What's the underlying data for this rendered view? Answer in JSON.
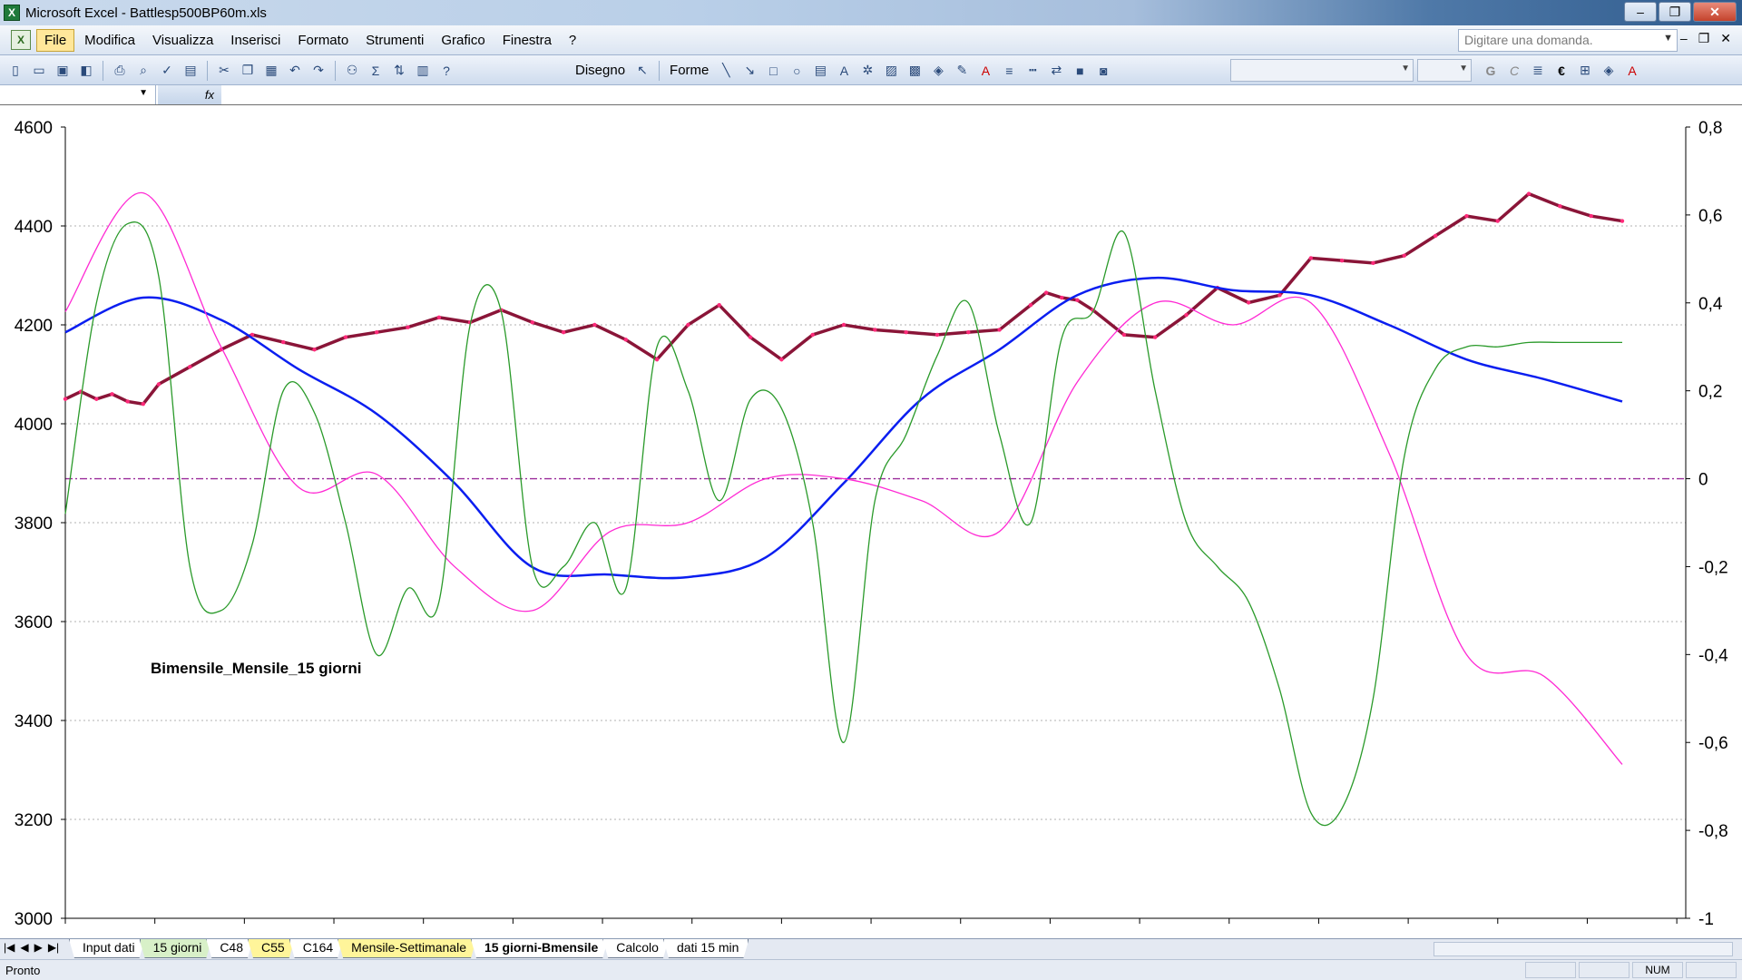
{
  "window": {
    "title": "Microsoft Excel - Battlesp500BP60m.xls",
    "app_icon": "excel-icon"
  },
  "menu": {
    "items": [
      "File",
      "Modifica",
      "Visualizza",
      "Inserisci",
      "Formato",
      "Strumenti",
      "Grafico",
      "Finestra",
      "?"
    ],
    "active": "File",
    "help_placeholder": "Digitare una domanda."
  },
  "toolbar": {
    "drawing_label": "Disegno",
    "shapes_label": "Forme",
    "currency_symbol": "€",
    "bold_label": "G",
    "italic_label": "C",
    "sum_symbol": "Σ"
  },
  "formula_bar": {
    "name_box": "",
    "fx_label": "fx",
    "content": ""
  },
  "chart_data": {
    "type": "line",
    "annotation": "Bimensile_Mensile_15 giorni",
    "annotation_color": "#1a8a1a",
    "ylim": [
      3000,
      4600
    ],
    "y_ticks": [
      "4600",
      "4400",
      "4200",
      "4000",
      "3800",
      "3600",
      "3400",
      "3200",
      "3000"
    ],
    "y2lim": [
      -1,
      0.8
    ],
    "y2_ticks": [
      "0,8",
      "0,6",
      "0,4",
      "0,2",
      "0",
      "-0,2",
      "-0,4",
      "-0,6",
      "-0,8",
      "-1"
    ],
    "grid": "horizontal dotted",
    "zero_line_color": "#9b2d9b",
    "x_range": [
      0,
      100
    ],
    "series": [
      {
        "axis": "left",
        "color": "#8a1538",
        "marker_color": "#ff2a7a",
        "x": [
          0,
          1,
          2,
          3,
          4,
          5,
          6,
          8,
          10,
          12,
          14,
          16,
          18,
          20,
          22,
          24,
          26,
          28,
          30,
          32,
          34,
          36,
          38,
          40,
          42,
          44,
          46,
          48,
          50,
          52,
          54,
          56,
          58,
          60,
          62,
          63,
          64,
          65,
          66,
          68,
          70,
          72,
          74,
          76,
          78,
          80,
          82,
          84,
          86,
          88,
          90,
          92,
          94,
          96,
          98,
          100
        ],
        "values": [
          4050,
          4065,
          4050,
          4060,
          4045,
          4040,
          4080,
          4115,
          4150,
          4180,
          4165,
          4150,
          4175,
          4185,
          4195,
          4215,
          4205,
          4230,
          4205,
          4185,
          4200,
          4170,
          4130,
          4200,
          4240,
          4175,
          4130,
          4180,
          4200,
          4190,
          4185,
          4180,
          4185,
          4190,
          4240,
          4265,
          4255,
          4250,
          4230,
          4180,
          4175,
          4220,
          4275,
          4245,
          4260,
          4335,
          4330,
          4325,
          4340,
          4380,
          4420,
          4410,
          4465,
          4440,
          4420,
          4410
        ]
      },
      {
        "axis": "left",
        "color": "#0a1ef0",
        "x": [
          0,
          5,
          10,
          15,
          20,
          25,
          30,
          35,
          40,
          45,
          50,
          55,
          60,
          65,
          70,
          75,
          80,
          85,
          90,
          95,
          100
        ],
        "values": [
          4185,
          4255,
          4210,
          4110,
          4020,
          3880,
          3710,
          3695,
          3690,
          3730,
          3880,
          4050,
          4150,
          4260,
          4295,
          4270,
          4260,
          4200,
          4130,
          4090,
          4045
        ]
      },
      {
        "axis": "right",
        "color": "#ff2ad4",
        "x": [
          0,
          5,
          10,
          15,
          20,
          25,
          30,
          35,
          40,
          45,
          50,
          55,
          60,
          65,
          70,
          75,
          80,
          85,
          90,
          95,
          100
        ],
        "values": [
          0.38,
          0.65,
          0.3,
          -0.02,
          0.01,
          -0.2,
          -0.3,
          -0.12,
          -0.1,
          0.0,
          0.0,
          -0.05,
          -0.12,
          0.22,
          0.4,
          0.35,
          0.4,
          0.06,
          -0.4,
          -0.45,
          -0.65
        ]
      },
      {
        "axis": "right",
        "color": "#2a9a2a",
        "x": [
          0,
          2,
          4,
          6,
          8,
          10,
          12,
          14,
          16,
          18,
          20,
          22,
          24,
          26,
          28,
          30,
          32,
          34,
          36,
          38,
          40,
          42,
          44,
          46,
          48,
          50,
          52,
          54,
          56,
          58,
          60,
          62,
          64,
          66,
          68,
          70,
          72,
          74,
          76,
          78,
          80,
          82,
          84,
          86,
          88,
          90,
          92,
          94,
          96,
          98,
          100
        ],
        "values": [
          -0.08,
          0.4,
          0.58,
          0.46,
          -0.2,
          -0.3,
          -0.15,
          0.2,
          0.15,
          -0.1,
          -0.4,
          -0.25,
          -0.28,
          0.35,
          0.38,
          -0.2,
          -0.2,
          -0.1,
          -0.25,
          0.3,
          0.2,
          -0.05,
          0.18,
          0.16,
          -0.1,
          -0.6,
          -0.05,
          0.1,
          0.28,
          0.4,
          0.1,
          -0.1,
          0.32,
          0.38,
          0.56,
          0.2,
          -0.1,
          -0.2,
          -0.28,
          -0.48,
          -0.76,
          -0.75,
          -0.5,
          0.05,
          0.25,
          0.3,
          0.3,
          0.31,
          0.31,
          0.31,
          0.31
        ]
      }
    ]
  },
  "sheet_tabs": [
    {
      "label": "Input dati",
      "color": "white"
    },
    {
      "label": "15 giorni",
      "color": "green"
    },
    {
      "label": "C48",
      "color": "white"
    },
    {
      "label": "C55",
      "color": "yellow"
    },
    {
      "label": "C164",
      "color": "white"
    },
    {
      "label": "Mensile-Settimanale",
      "color": "yellow"
    },
    {
      "label": "15 giorni-Bmensile",
      "color": "active"
    },
    {
      "label": "Calcolo",
      "color": "white"
    },
    {
      "label": "dati 15 min",
      "color": "white"
    }
  ],
  "status": {
    "text": "Pronto",
    "indicator": "NUM"
  }
}
